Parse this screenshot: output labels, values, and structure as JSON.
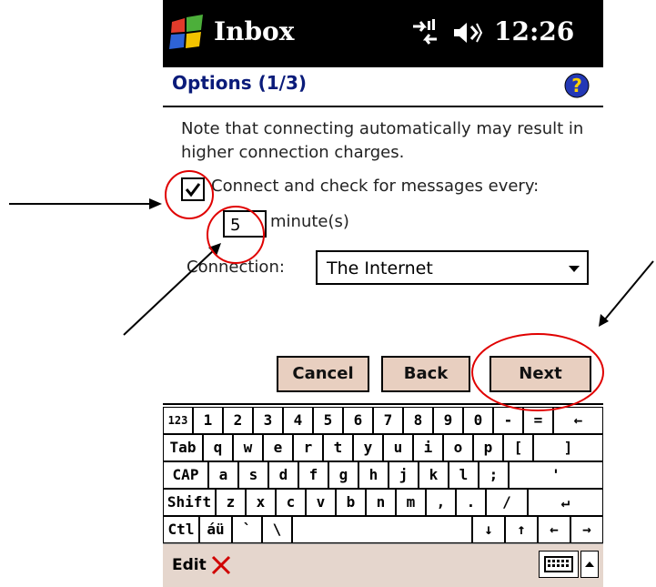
{
  "titlebar": {
    "app_title": "Inbox",
    "time": "12:26",
    "icons": [
      "windows-start-icon",
      "connectivity-icon",
      "volume-icon"
    ]
  },
  "header": {
    "title": "Options (1/3)",
    "help_icon": "help-icon"
  },
  "content": {
    "note": "Note that connecting automatically may result in higher connection charges.",
    "checkbox_label": "Connect and check for messages every:",
    "checkbox_checked": true,
    "interval_value": "5",
    "interval_unit": "minute(s)",
    "connection_label": "Connection:",
    "connection_value": "The Internet"
  },
  "buttons": {
    "cancel": "Cancel",
    "back": "Back",
    "next": "Next"
  },
  "keyboard": {
    "row1": [
      "123",
      "1",
      "2",
      "3",
      "4",
      "5",
      "6",
      "7",
      "8",
      "9",
      "0",
      "-",
      "=",
      "←"
    ],
    "row2": [
      "Tab",
      "q",
      "w",
      "e",
      "r",
      "t",
      "y",
      "u",
      "i",
      "o",
      "p",
      "[",
      "]"
    ],
    "row3": [
      "CAP",
      "a",
      "s",
      "d",
      "f",
      "g",
      "h",
      "j",
      "k",
      "l",
      ";",
      "'"
    ],
    "row4": [
      "Shift",
      "z",
      "x",
      "c",
      "v",
      "b",
      "n",
      "m",
      ",",
      ".",
      "/",
      "↵"
    ],
    "row5": [
      "Ctl",
      "áü",
      "`",
      "\\",
      "↓",
      "↑",
      "←",
      "→"
    ]
  },
  "menubar": {
    "edit": "Edit"
  },
  "colors": {
    "titlebar": "#000000",
    "header_title": "#0a1b7a",
    "button_bg": "#e8cfc0",
    "annotation": "#e00000"
  }
}
